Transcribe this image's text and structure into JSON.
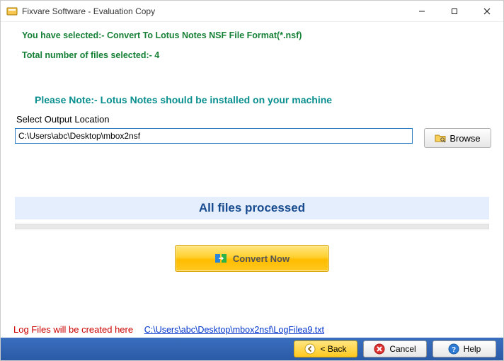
{
  "window": {
    "title": "Fixvare Software - Evaluation Copy"
  },
  "info": {
    "selected_label": "You have selected:- Convert To Lotus Notes NSF File Format(*.nsf)",
    "count_label": "Total number of files selected:- 4",
    "note": "Please Note:- Lotus Notes should be installed on your machine"
  },
  "output": {
    "label": "Select Output Location",
    "path": "C:\\Users\\abc\\Desktop\\mbox2nsf",
    "browse_label": "Browse"
  },
  "status": {
    "text": "All files processed"
  },
  "actions": {
    "convert_label": "Convert Now"
  },
  "log": {
    "prefix": "Log Files will be created here",
    "link": "C:\\Users\\abc\\Desktop\\mbox2nsf\\LogFilea9.txt"
  },
  "buttons": {
    "back": "< Back",
    "cancel": "Cancel",
    "help": "Help"
  }
}
